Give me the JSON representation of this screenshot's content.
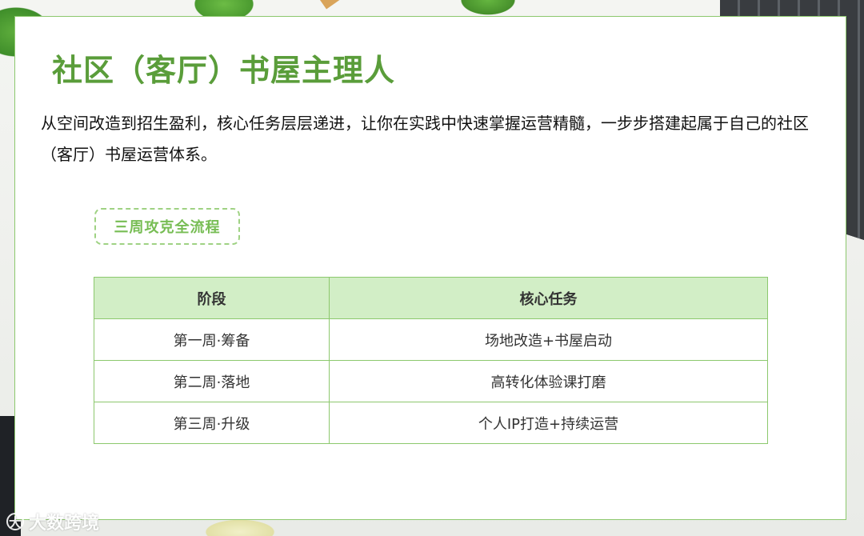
{
  "page": {
    "title": "社区（客厅）书屋主理人",
    "intro": "从空间改造到招生盈利，核心任务层层递进，让你在实践中快速掌握运营精髓，一步步搭建起属于自己的社区（客厅）书屋运营体系。",
    "tag": "三周攻克全流程"
  },
  "table": {
    "headers": [
      "阶段",
      "核心任务"
    ],
    "rows": [
      [
        "第一周·筹备",
        "场地改造+书屋启动"
      ],
      [
        "第二周·落地",
        "高转化体验课打磨"
      ],
      [
        "第三周·升级",
        "个人IP打造+持续运营"
      ]
    ]
  },
  "watermark": {
    "mark": "大",
    "text": "大数跨境"
  },
  "colors": {
    "accent": "#5a9d3a",
    "border": "#8cc86d",
    "header_bg": "#d2eec6",
    "tag": "#77bd54"
  }
}
